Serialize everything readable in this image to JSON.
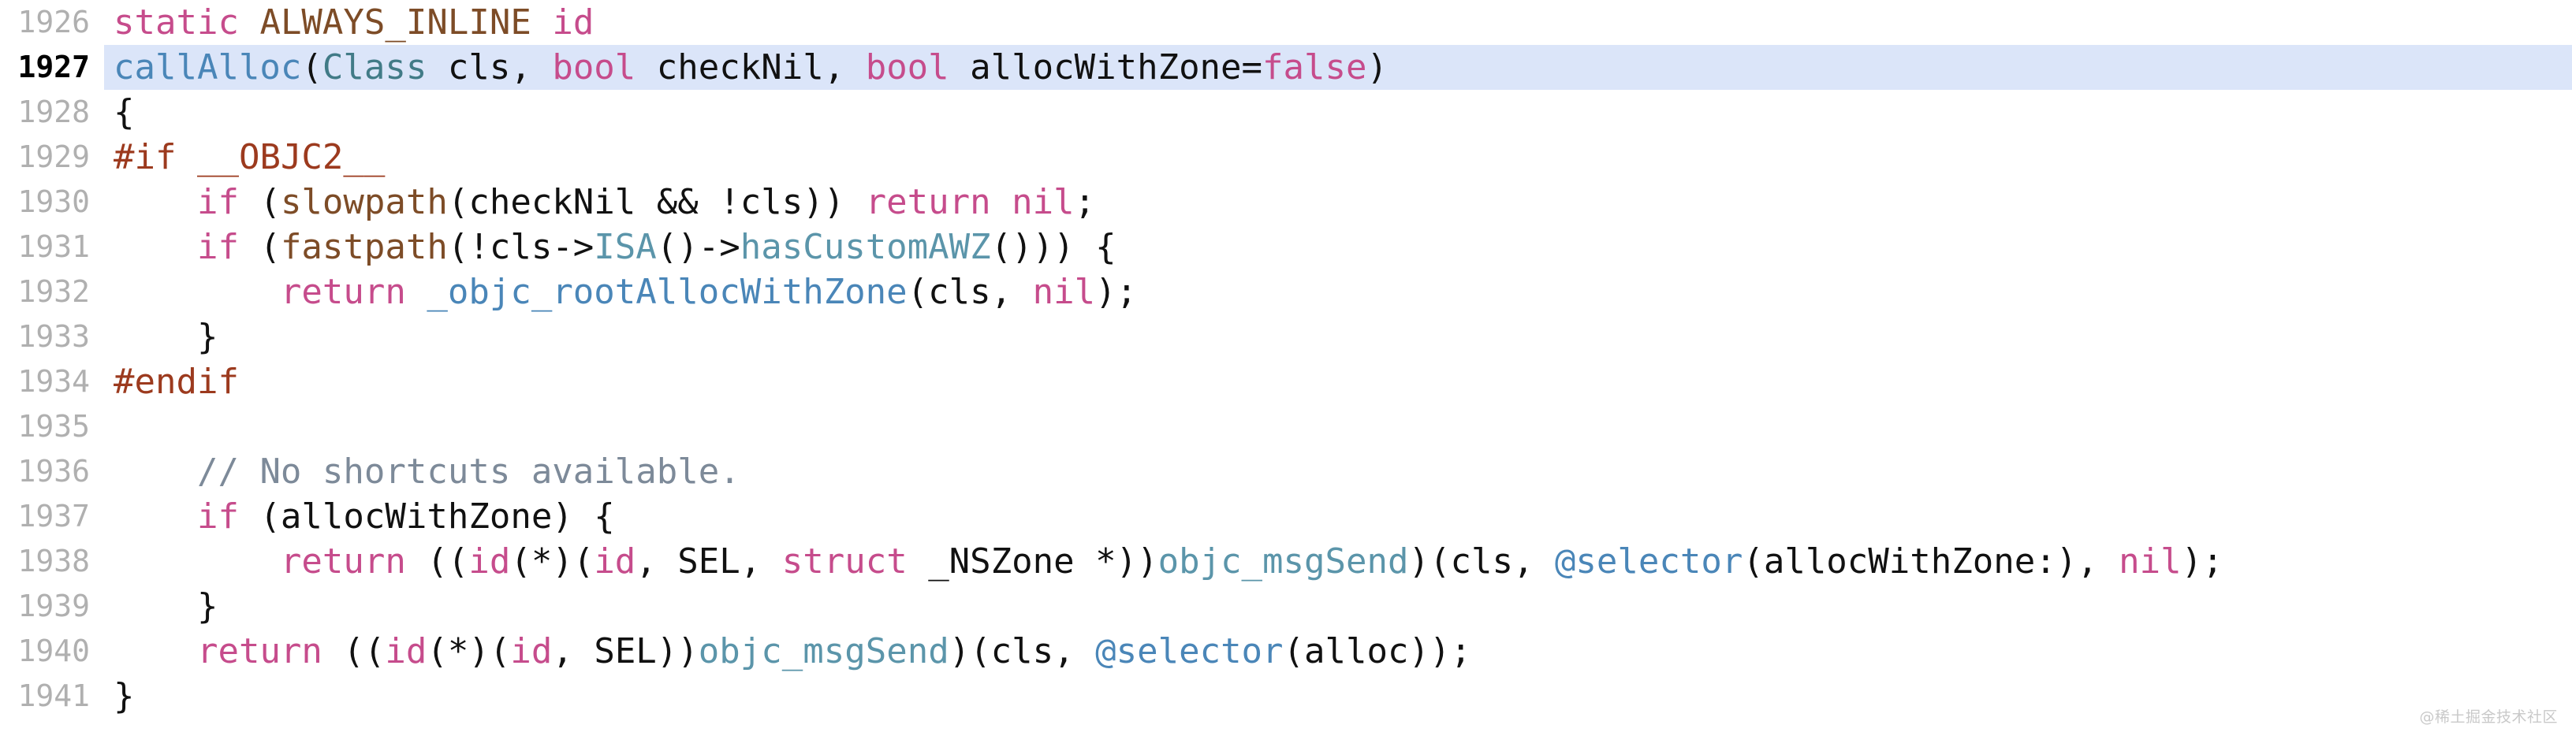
{
  "editor": {
    "language": "objective-c",
    "highlighted_line": 1927,
    "first_line": 1926,
    "last_line": 1941,
    "background_color": "#ffffff",
    "highlight_color": "#dbe5f9",
    "line_number_color": "#b0b0b0"
  },
  "palette": {
    "plain": "#111111",
    "keyword": "#c64c8c",
    "preproc": "#9c3a1e",
    "macro": "#7d4c27",
    "function": "#4a86b8",
    "type": "#417b87",
    "member": "#5b95aa",
    "comment": "#7d8a99"
  },
  "watermark": "@稀土掘金技术社区",
  "lines": [
    {
      "number": "1926",
      "highlighted": false,
      "tokens": [
        {
          "text": "static",
          "kind": "keyword"
        },
        {
          "text": " ",
          "kind": "plain"
        },
        {
          "text": "ALWAYS_INLINE",
          "kind": "macro"
        },
        {
          "text": " ",
          "kind": "plain"
        },
        {
          "text": "id",
          "kind": "keyword"
        }
      ]
    },
    {
      "number": "1927",
      "highlighted": true,
      "tokens": [
        {
          "text": "callAlloc",
          "kind": "function"
        },
        {
          "text": "(",
          "kind": "plain"
        },
        {
          "text": "Class",
          "kind": "type"
        },
        {
          "text": " cls, ",
          "kind": "plain"
        },
        {
          "text": "bool",
          "kind": "keyword"
        },
        {
          "text": " checkNil, ",
          "kind": "plain"
        },
        {
          "text": "bool",
          "kind": "keyword"
        },
        {
          "text": " allocWithZone=",
          "kind": "plain"
        },
        {
          "text": "false",
          "kind": "keyword"
        },
        {
          "text": ")",
          "kind": "plain"
        }
      ]
    },
    {
      "number": "1928",
      "highlighted": false,
      "tokens": [
        {
          "text": "{",
          "kind": "plain"
        }
      ]
    },
    {
      "number": "1929",
      "highlighted": false,
      "tokens": [
        {
          "text": "#if",
          "kind": "preproc"
        },
        {
          "text": " ",
          "kind": "plain"
        },
        {
          "text": "__OBJC2__",
          "kind": "preproc"
        }
      ]
    },
    {
      "number": "1930",
      "highlighted": false,
      "tokens": [
        {
          "text": "    ",
          "kind": "plain"
        },
        {
          "text": "if",
          "kind": "keyword"
        },
        {
          "text": " (",
          "kind": "plain"
        },
        {
          "text": "slowpath",
          "kind": "macro"
        },
        {
          "text": "(checkNil && !cls)) ",
          "kind": "plain"
        },
        {
          "text": "return",
          "kind": "keyword"
        },
        {
          "text": " ",
          "kind": "plain"
        },
        {
          "text": "nil",
          "kind": "keyword"
        },
        {
          "text": ";",
          "kind": "plain"
        }
      ]
    },
    {
      "number": "1931",
      "highlighted": false,
      "tokens": [
        {
          "text": "    ",
          "kind": "plain"
        },
        {
          "text": "if",
          "kind": "keyword"
        },
        {
          "text": " (",
          "kind": "plain"
        },
        {
          "text": "fastpath",
          "kind": "macro"
        },
        {
          "text": "(!cls->",
          "kind": "plain"
        },
        {
          "text": "ISA",
          "kind": "member"
        },
        {
          "text": "()->",
          "kind": "plain"
        },
        {
          "text": "hasCustomAWZ",
          "kind": "member"
        },
        {
          "text": "())) {",
          "kind": "plain"
        }
      ]
    },
    {
      "number": "1932",
      "highlighted": false,
      "tokens": [
        {
          "text": "        ",
          "kind": "plain"
        },
        {
          "text": "return",
          "kind": "keyword"
        },
        {
          "text": " ",
          "kind": "plain"
        },
        {
          "text": "_objc_rootAllocWithZone",
          "kind": "function"
        },
        {
          "text": "(cls, ",
          "kind": "plain"
        },
        {
          "text": "nil",
          "kind": "keyword"
        },
        {
          "text": ");",
          "kind": "plain"
        }
      ]
    },
    {
      "number": "1933",
      "highlighted": false,
      "tokens": [
        {
          "text": "    }",
          "kind": "plain"
        }
      ]
    },
    {
      "number": "1934",
      "highlighted": false,
      "tokens": [
        {
          "text": "#endif",
          "kind": "preproc"
        }
      ]
    },
    {
      "number": "1935",
      "highlighted": false,
      "tokens": []
    },
    {
      "number": "1936",
      "highlighted": false,
      "tokens": [
        {
          "text": "    ",
          "kind": "plain"
        },
        {
          "text": "// No shortcuts available.",
          "kind": "comment"
        }
      ]
    },
    {
      "number": "1937",
      "highlighted": false,
      "tokens": [
        {
          "text": "    ",
          "kind": "plain"
        },
        {
          "text": "if",
          "kind": "keyword"
        },
        {
          "text": " (allocWithZone) {",
          "kind": "plain"
        }
      ]
    },
    {
      "number": "1938",
      "highlighted": false,
      "tokens": [
        {
          "text": "        ",
          "kind": "plain"
        },
        {
          "text": "return",
          "kind": "keyword"
        },
        {
          "text": " ((",
          "kind": "plain"
        },
        {
          "text": "id",
          "kind": "keyword"
        },
        {
          "text": "(*)(",
          "kind": "plain"
        },
        {
          "text": "id",
          "kind": "keyword"
        },
        {
          "text": ", ",
          "kind": "plain"
        },
        {
          "text": "SEL",
          "kind": "plain"
        },
        {
          "text": ", ",
          "kind": "plain"
        },
        {
          "text": "struct",
          "kind": "keyword"
        },
        {
          "text": " _NSZone *))",
          "kind": "plain"
        },
        {
          "text": "objc_msgSend",
          "kind": "member"
        },
        {
          "text": ")(cls, ",
          "kind": "plain"
        },
        {
          "text": "@selector",
          "kind": "function"
        },
        {
          "text": "(allocWithZone:), ",
          "kind": "plain"
        },
        {
          "text": "nil",
          "kind": "keyword"
        },
        {
          "text": ");",
          "kind": "plain"
        }
      ]
    },
    {
      "number": "1939",
      "highlighted": false,
      "tokens": [
        {
          "text": "    }",
          "kind": "plain"
        }
      ]
    },
    {
      "number": "1940",
      "highlighted": false,
      "tokens": [
        {
          "text": "    ",
          "kind": "plain"
        },
        {
          "text": "return",
          "kind": "keyword"
        },
        {
          "text": " ((",
          "kind": "plain"
        },
        {
          "text": "id",
          "kind": "keyword"
        },
        {
          "text": "(*)(",
          "kind": "plain"
        },
        {
          "text": "id",
          "kind": "keyword"
        },
        {
          "text": ", ",
          "kind": "plain"
        },
        {
          "text": "SEL",
          "kind": "plain"
        },
        {
          "text": "))",
          "kind": "plain"
        },
        {
          "text": "objc_msgSend",
          "kind": "member"
        },
        {
          "text": ")(cls, ",
          "kind": "plain"
        },
        {
          "text": "@selector",
          "kind": "function"
        },
        {
          "text": "(alloc));",
          "kind": "plain"
        }
      ]
    },
    {
      "number": "1941",
      "highlighted": false,
      "tokens": [
        {
          "text": "}",
          "kind": "plain"
        }
      ]
    }
  ]
}
